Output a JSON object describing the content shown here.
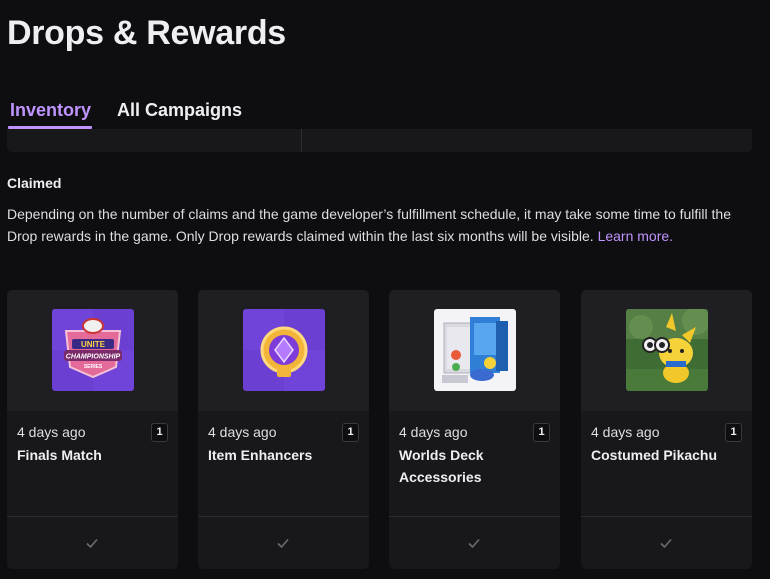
{
  "page": {
    "title": "Drops & Rewards"
  },
  "tabs": [
    {
      "label": "Inventory",
      "active": true
    },
    {
      "label": "All Campaigns",
      "active": false
    }
  ],
  "claimed": {
    "heading": "Claimed",
    "description": "Depending on the number of claims and the game developer’s fulfillment schedule, it may take some time to fulfill the Drop rewards in the game. Only Drop rewards claimed within the last six months will be visible.",
    "learn_more": "Learn more."
  },
  "rewards": [
    {
      "time": "4 days ago",
      "quantity": "1",
      "name": "Finals Match",
      "icon": "unite-championship-series-logo"
    },
    {
      "time": "4 days ago",
      "quantity": "1",
      "name": "Item Enhancers",
      "icon": "item-enhancer-gem"
    },
    {
      "time": "4 days ago",
      "quantity": "1",
      "name": "Worlds Deck Accessories",
      "icon": "deck-box-accessories"
    },
    {
      "time": "4 days ago",
      "quantity": "1",
      "name": "Costumed Pikachu",
      "icon": "costumed-pikachu"
    }
  ],
  "colors": {
    "accent": "#bf94ff",
    "background": "#0e0e10",
    "card": "#18181b"
  }
}
